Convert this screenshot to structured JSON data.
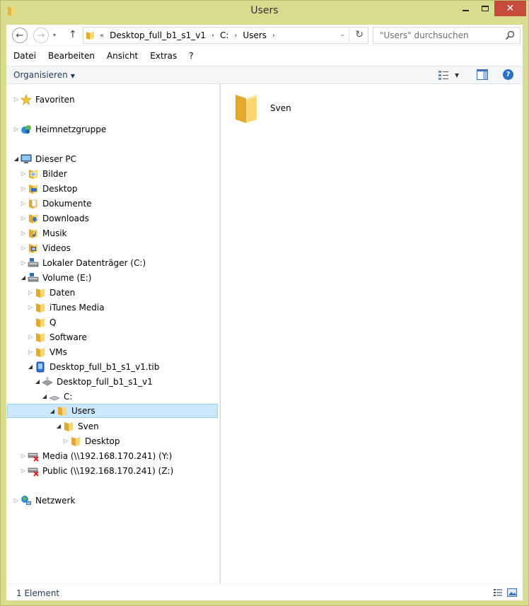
{
  "window": {
    "title": "Users",
    "close_glyph": "✕"
  },
  "nav": {
    "back_glyph": "←",
    "forward_glyph": "→",
    "recent_glyph": "▾",
    "up_glyph": "↑",
    "refresh_glyph": "↻"
  },
  "address": {
    "overflow": "«",
    "segments": [
      "Desktop_full_b1_s1_v1",
      "C:",
      "Users"
    ],
    "separator": "›",
    "dropdown_glyph": "⌄"
  },
  "search": {
    "placeholder": "\"Users\" durchsuchen"
  },
  "menu": {
    "items": [
      "Datei",
      "Bearbeiten",
      "Ansicht",
      "Extras",
      "?"
    ]
  },
  "command": {
    "organize": "Organisieren",
    "organize_arrow": "▼",
    "view_arrow": "▼",
    "help": "?"
  },
  "tree": {
    "items": [
      {
        "label": "Favoriten",
        "icon": "star-icon"
      },
      {
        "label": "Heimnetzgruppe",
        "icon": "homegroup-icon"
      },
      {
        "label": "Dieser PC",
        "icon": "computer-icon"
      },
      {
        "label": "Bilder",
        "icon": "pictures-folder-icon"
      },
      {
        "label": "Desktop",
        "icon": "desktop-folder-icon"
      },
      {
        "label": "Dokumente",
        "icon": "documents-folder-icon"
      },
      {
        "label": "Downloads",
        "icon": "downloads-folder-icon"
      },
      {
        "label": "Musik",
        "icon": "music-folder-icon"
      },
      {
        "label": "Videos",
        "icon": "videos-folder-icon"
      },
      {
        "label": "Lokaler Datenträger (C:)",
        "icon": "drive-icon"
      },
      {
        "label": "Volume (E:)",
        "icon": "drive-icon"
      },
      {
        "label": "Daten",
        "icon": "folder-icon"
      },
      {
        "label": "iTunes Media",
        "icon": "folder-icon"
      },
      {
        "label": "Q",
        "icon": "folder-icon"
      },
      {
        "label": "Software",
        "icon": "folder-icon"
      },
      {
        "label": "VMs",
        "icon": "folder-icon"
      },
      {
        "label": "Desktop_full_b1_s1_v1.tib",
        "icon": "tib-file-icon"
      },
      {
        "label": "Desktop_full_b1_s1_v1",
        "icon": "mounted-image-icon"
      },
      {
        "label": "C:",
        "icon": "drive-small-icon"
      },
      {
        "label": "Users",
        "icon": "folder-icon"
      },
      {
        "label": "Sven",
        "icon": "folder-icon"
      },
      {
        "label": "Desktop",
        "icon": "folder-icon"
      },
      {
        "label": "Media (\\\\192.168.170.241) (Y:)",
        "icon": "disconnected-network-drive-icon"
      },
      {
        "label": "Public (\\\\192.168.170.241) (Z:)",
        "icon": "disconnected-network-drive-icon"
      },
      {
        "label": "Netzwerk",
        "icon": "network-icon"
      }
    ],
    "expand_glyph": "▷",
    "collapse_glyph": "◢"
  },
  "content": {
    "items": [
      {
        "label": "Sven",
        "icon": "folder-icon"
      }
    ]
  },
  "status": {
    "count": "1 Element"
  }
}
